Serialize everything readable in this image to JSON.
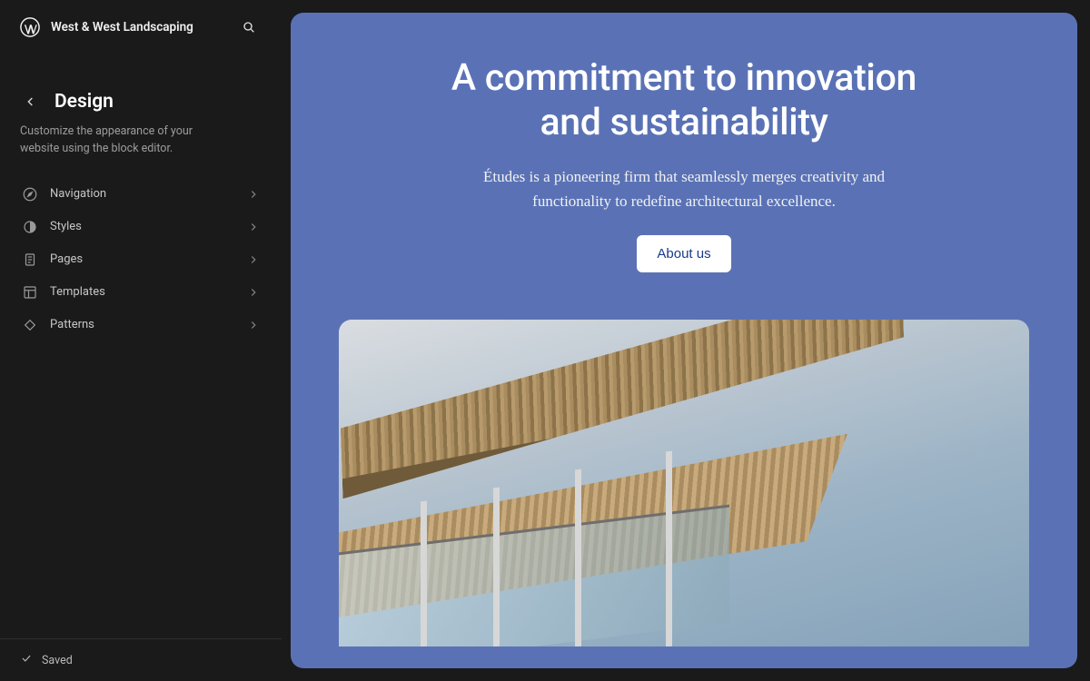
{
  "topbar": {
    "site_title": "West & West Landscaping"
  },
  "design": {
    "title": "Design",
    "description": "Customize the appearance of your website using the block editor."
  },
  "nav": {
    "items": [
      {
        "icon": "compass-icon",
        "label": "Navigation"
      },
      {
        "icon": "half-circle-icon",
        "label": "Styles"
      },
      {
        "icon": "page-icon",
        "label": "Pages"
      },
      {
        "icon": "layout-icon",
        "label": "Templates"
      },
      {
        "icon": "diamond-icon",
        "label": "Patterns"
      }
    ]
  },
  "footer": {
    "status": "Saved"
  },
  "preview": {
    "hero_title_line1": "A commitment to innovation",
    "hero_title_line2": "and sustainability",
    "hero_subtext": "Études is a pioneering firm that seamlessly merges creativity and functionality to redefine architectural excellence.",
    "cta_label": "About us"
  },
  "colors": {
    "canvas_bg": "#5a72b5",
    "cta_text": "#1a3a8f"
  }
}
